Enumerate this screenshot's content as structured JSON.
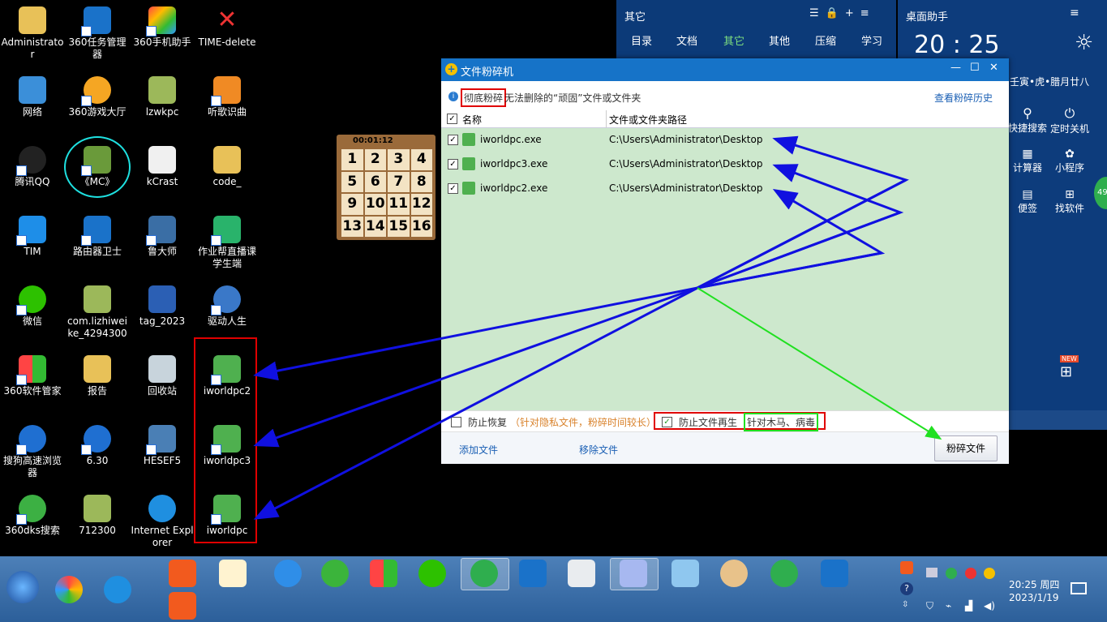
{
  "desktop": {
    "icons": [
      {
        "label": "Administrator"
      },
      {
        "label": "网络"
      },
      {
        "label": "腾讯QQ"
      },
      {
        "label": "TIM"
      },
      {
        "label": "微信"
      },
      {
        "label": "360软件管家"
      },
      {
        "label": "搜狗高速浏览器"
      },
      {
        "label": "360dks搜索"
      },
      {
        "label": "360任务管理器"
      },
      {
        "label": "360游戏大厅"
      },
      {
        "label": "《MC》"
      },
      {
        "label": "路由器卫士"
      },
      {
        "label": "com.lizhiweike_4294300"
      },
      {
        "label": "报告"
      },
      {
        "label": "6.30"
      },
      {
        "label": "712300"
      },
      {
        "label": "360手机助手"
      },
      {
        "label": "lzwkpc"
      },
      {
        "label": "kCrast"
      },
      {
        "label": "鲁大师"
      },
      {
        "label": "tag_2023"
      },
      {
        "label": "回收站"
      },
      {
        "label": "HESEF5"
      },
      {
        "label": "Internet Explorer"
      },
      {
        "label": "TIME-delete"
      },
      {
        "label": "听歌识曲"
      },
      {
        "label": "code_"
      },
      {
        "label": "作业帮直播课学生端"
      },
      {
        "label": "驱动人生"
      },
      {
        "label": "iworldpc2"
      },
      {
        "label": "iworldpc3"
      },
      {
        "label": "iworldpc"
      }
    ],
    "puzzle": {
      "timer": "00:01:12",
      "tiles": [
        "1",
        "2",
        "3",
        "4",
        "5",
        "6",
        "7",
        "8",
        "9",
        "10",
        "11",
        "12",
        "13",
        "14",
        "15",
        "16"
      ]
    }
  },
  "other_panel": {
    "title": "其它",
    "tabs": [
      "目录",
      "文档",
      "其它",
      "其他",
      "压缩",
      "学习"
    ],
    "active_tab": "其它"
  },
  "assistant": {
    "title": "桌面助手",
    "time": "20 : 25",
    "lunar": "壬寅•虎•腊月廿八",
    "tools": [
      {
        "label": "快捷搜索"
      },
      {
        "label": "定时关机"
      },
      {
        "label": "计算器"
      },
      {
        "label": "小程序"
      },
      {
        "label": "便签"
      },
      {
        "label": "找软件"
      }
    ],
    "badge": "NEW",
    "side_badge": "49"
  },
  "shredder": {
    "title": "文件粉碎机",
    "info_highlight": "彻底粉碎",
    "info_rest": "无法删除的“顽固”文件或文件夹",
    "history_link": "查看粉碎历史",
    "col_name": "名称",
    "col_path": "文件或文件夹路径",
    "files": [
      {
        "name": "iworldpc.exe",
        "path": "C:\\Users\\Administrator\\Desktop"
      },
      {
        "name": "iworldpc3.exe",
        "path": "C:\\Users\\Administrator\\Desktop"
      },
      {
        "name": "iworldpc2.exe",
        "path": "C:\\Users\\Administrator\\Desktop"
      }
    ],
    "opt1_label": "防止恢复",
    "opt1_note": "（针对隐私文件，粉碎时间较长）",
    "opt2_label": "防止文件再生",
    "opt2_note": "针对木马、病毒",
    "add_file": "添加文件",
    "remove_file": "移除文件",
    "shred_button": "粉碎文件"
  },
  "taskbar": {
    "time": "20:25 周四",
    "date": "2023/1/19"
  },
  "colors": {
    "annotation_red": "#e00000",
    "annotation_blue": "#1010e0",
    "annotation_green": "#20e020",
    "window_blue": "#1673c8",
    "list_green": "#cde8cd"
  }
}
